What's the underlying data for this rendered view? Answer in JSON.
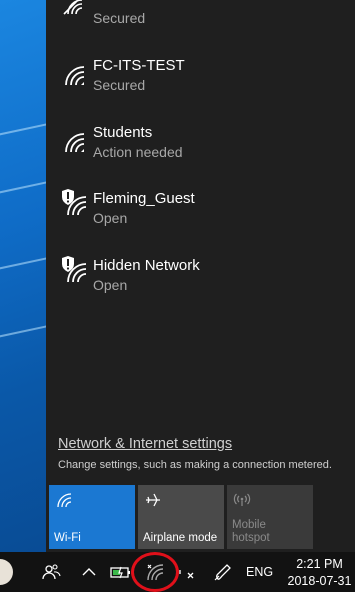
{
  "networks": [
    {
      "ssid": "",
      "status": "Secured",
      "secured": false
    },
    {
      "ssid": "FC-ITS-TEST",
      "status": "Secured",
      "secured": false
    },
    {
      "ssid": "Students",
      "status": "Action needed",
      "secured": false
    },
    {
      "ssid": "Fleming_Guest",
      "status": "Open",
      "secured": true
    },
    {
      "ssid": "Hidden Network",
      "status": "Open",
      "secured": true
    }
  ],
  "settings": {
    "link": "Network & Internet settings",
    "description": "Change settings, such as making a connection metered."
  },
  "quick_actions": {
    "wifi": "Wi-Fi",
    "airplane": "Airplane mode",
    "hotspot": "Mobile hotspot"
  },
  "taskbar": {
    "language": "ENG",
    "time": "2:21 PM",
    "date": "2018-07-31"
  },
  "colors": {
    "accent": "#1b78d2",
    "highlight_circle": "#e0101a"
  }
}
